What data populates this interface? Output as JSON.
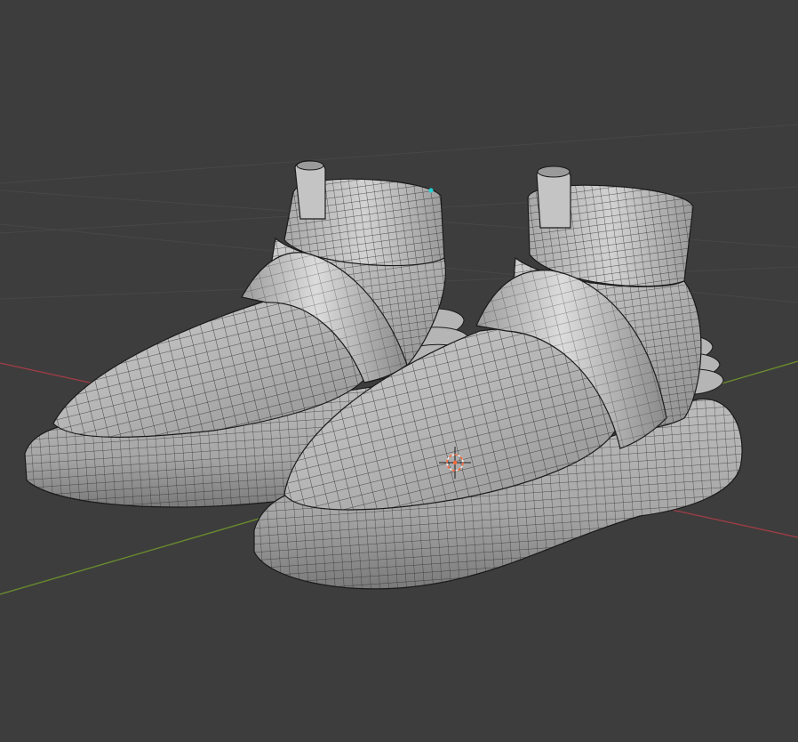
{
  "viewport": {
    "name": "3D Viewport",
    "background": "#3d3d3d",
    "grid_color": "#4a4a4a",
    "x_axis_color": "#9c3d45",
    "y_axis_color": "#6a8a2e"
  },
  "scene_objects": [
    {
      "name": "left-sneaker",
      "kind": "mesh",
      "display": "solid-wireframe",
      "selected": false
    },
    {
      "name": "right-sneaker",
      "kind": "mesh",
      "display": "solid-wireframe",
      "selected": false
    }
  ],
  "cursor": {
    "icon": "3d-cursor-icon",
    "color": "#ff6a3a"
  },
  "mesh_style": {
    "fill": "#a9a9a9",
    "highlight": "#d6d6d6",
    "shadow": "#6e6e6e",
    "wire": "#1a1a1a"
  }
}
